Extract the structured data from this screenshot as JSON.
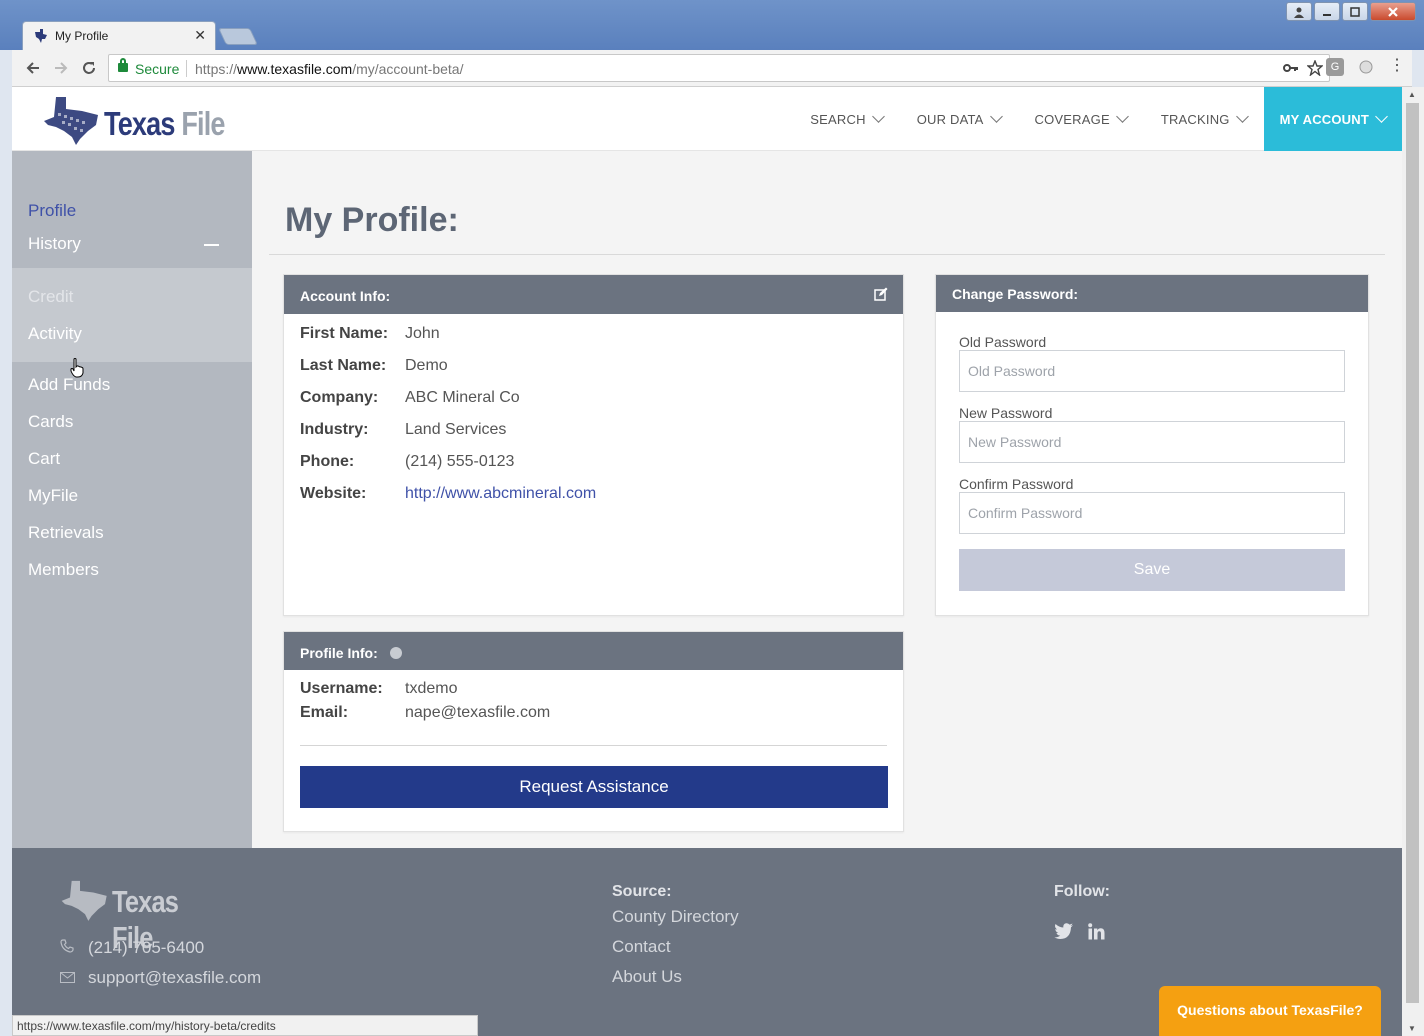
{
  "browser": {
    "tab_title": "My Profile",
    "tab_close": "✕",
    "secure_label": "Secure",
    "url_scheme": "https://",
    "url_host": "www.texasfile.com",
    "url_path": "/my/account-beta/",
    "status_url": "https://www.texasfile.com/my/history-beta/credits",
    "window_buttons": [
      "user",
      "minimize",
      "maximize",
      "close"
    ]
  },
  "header": {
    "logo_word1": "Texas",
    "logo_word2": "File",
    "nav": [
      {
        "label": "SEARCH"
      },
      {
        "label": "OUR DATA"
      },
      {
        "label": "COVERAGE"
      },
      {
        "label": "TRACKING"
      },
      {
        "label": "MY ACCOUNT",
        "active": true
      }
    ]
  },
  "sidebar": {
    "items": [
      {
        "label": "Profile",
        "state": "active"
      },
      {
        "label": "History",
        "state": "expanded"
      },
      {
        "label": "Credit",
        "state": "hover"
      },
      {
        "label": "Activity"
      },
      {
        "label": "Add Funds"
      },
      {
        "label": "Cards"
      },
      {
        "label": "Cart"
      },
      {
        "label": "MyFile"
      },
      {
        "label": "Retrievals"
      },
      {
        "label": "Members"
      }
    ]
  },
  "main": {
    "title": "My Profile:",
    "account_info": {
      "heading": "Account Info:",
      "fields": [
        {
          "label": "First Name:",
          "value": "John"
        },
        {
          "label": "Last Name:",
          "value": "Demo"
        },
        {
          "label": "Company:",
          "value": "ABC Mineral Co"
        },
        {
          "label": "Industry:",
          "value": "Land Services"
        },
        {
          "label": "Phone:",
          "value": "(214) 555-0123"
        },
        {
          "label": "Website:",
          "value": "http://www.abcmineral.com"
        }
      ]
    },
    "profile_info": {
      "heading": "Profile Info:",
      "fields": [
        {
          "label": "Username:",
          "value": "txdemo"
        },
        {
          "label": "Email:",
          "value": "nape@texasfile.com"
        }
      ],
      "assist_label": "Request Assistance"
    },
    "change_password": {
      "heading": "Change Password:",
      "old_label": "Old Password",
      "old_placeholder": "Old Password",
      "new_label": "New Password",
      "new_placeholder": "New Password",
      "confirm_label": "Confirm Password",
      "confirm_placeholder": "Confirm Password",
      "save_label": "Save"
    }
  },
  "footer": {
    "logo_word1": "Texas",
    "logo_word2": "File",
    "phone": "(214) 705-6400",
    "email": "support@texasfile.com",
    "source_heading": "Source:",
    "links": [
      "County Directory",
      "Contact",
      "About Us"
    ],
    "follow_heading": "Follow:",
    "social": [
      "twitter-icon",
      "linkedin-icon"
    ]
  },
  "chat": {
    "label": "Questions about TexasFile?"
  },
  "colors": {
    "accent_nav": "#2bbcd9",
    "primary_button": "#233a8a",
    "card_header": "#6b7380",
    "sidebar": "#b3b8c0",
    "chat_button": "#f5a011"
  }
}
